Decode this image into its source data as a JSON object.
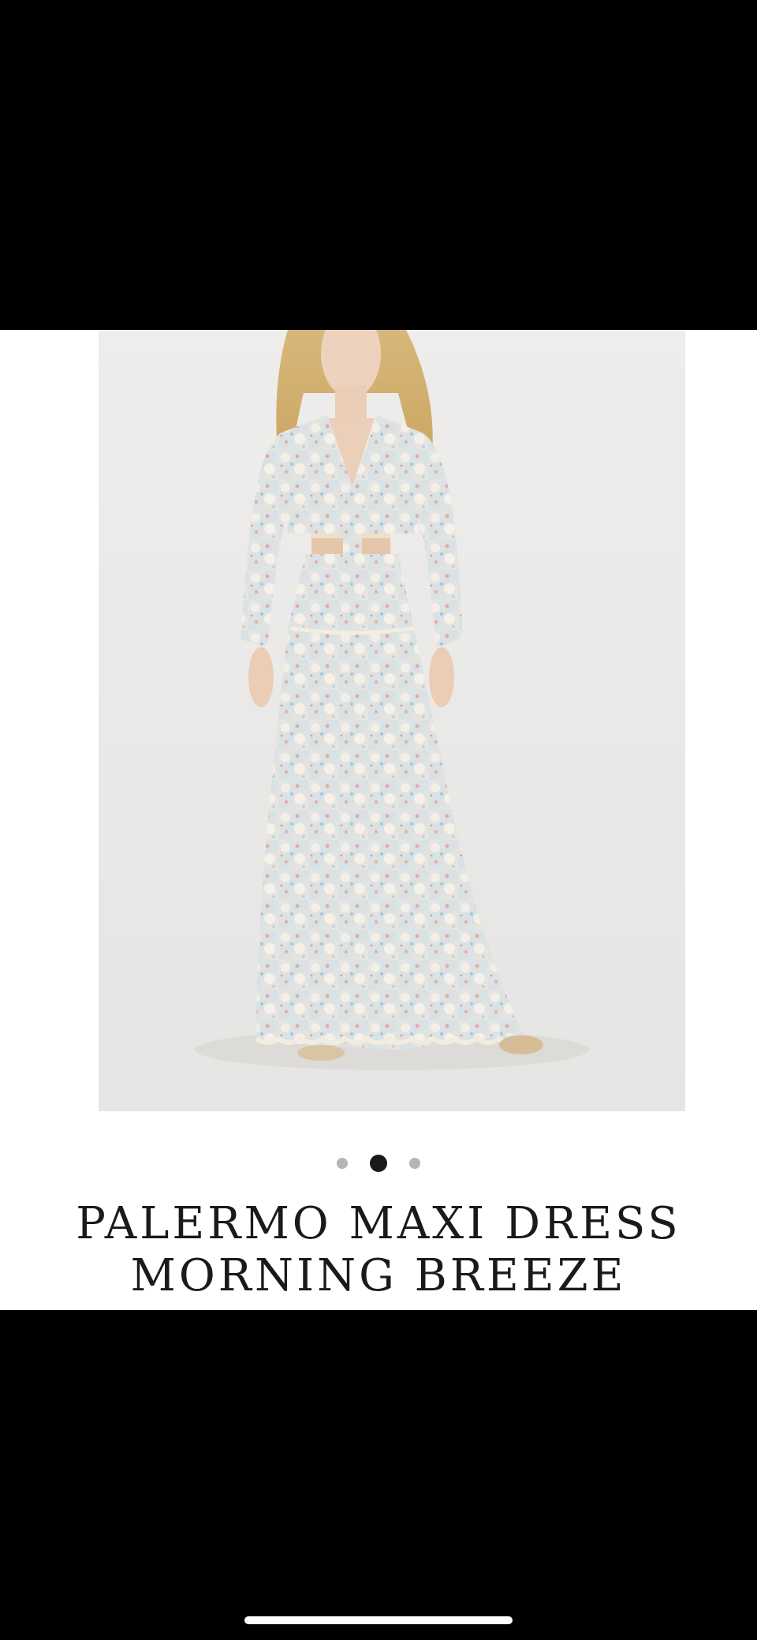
{
  "product": {
    "title_line1": "PALERMO MAXI DRESS",
    "title_line2": "MORNING BREEZE",
    "image_alt": "Palermo Maxi Dress Morning Breeze",
    "gallery": {
      "count": 3,
      "active_index": 1
    }
  },
  "icons": {
    "zoom": "magnifying-glass-icon"
  },
  "colors": {
    "image_background": "#ecebea",
    "title_text": "#1a1a1a",
    "dot_active": "#1a1a1a",
    "dot_inactive": "#b5b5b5"
  }
}
